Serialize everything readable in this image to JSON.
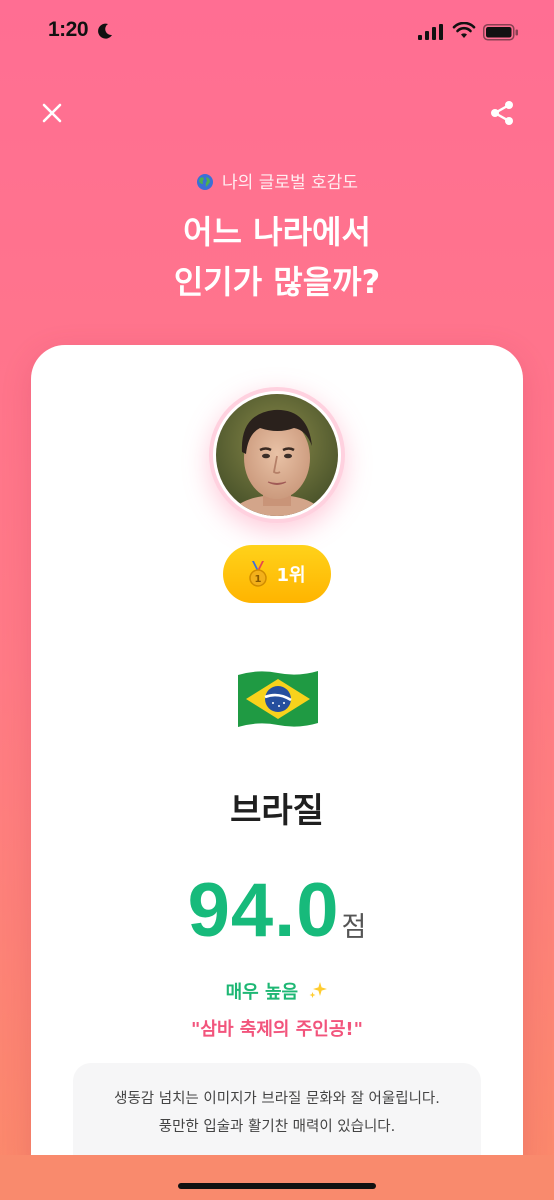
{
  "status_bar": {
    "time": "1:20"
  },
  "header": {
    "subtitle": "나의 글로벌 호감도",
    "title_line1": "어느 나라에서",
    "title_line2": "인기가 많을까?"
  },
  "result": {
    "rank": "1위",
    "country": "브라질",
    "score": "94.0",
    "score_unit": "점",
    "level": "매우 높음",
    "tagline": "\"삼바 축제의 주인공!\"",
    "description_line1": "생동감 넘치는 이미지가 브라질 문화와 잘 어울립니다.",
    "description_line2": "풍만한 입술과 활기찬 매력이 있습니다."
  },
  "colors": {
    "background_top": "#ff6e93",
    "background_bottom": "#fb8a6a",
    "score": "#17ba7b",
    "level": "#1eb774",
    "tagline": "#f2547c",
    "badge": "#ffc107"
  },
  "icons": {
    "close": "close-icon",
    "share": "share-icon",
    "globe": "globe-icon",
    "medal": "medal-icon",
    "flag": "brazil-flag-icon",
    "sparkles": "sparkles-icon"
  }
}
